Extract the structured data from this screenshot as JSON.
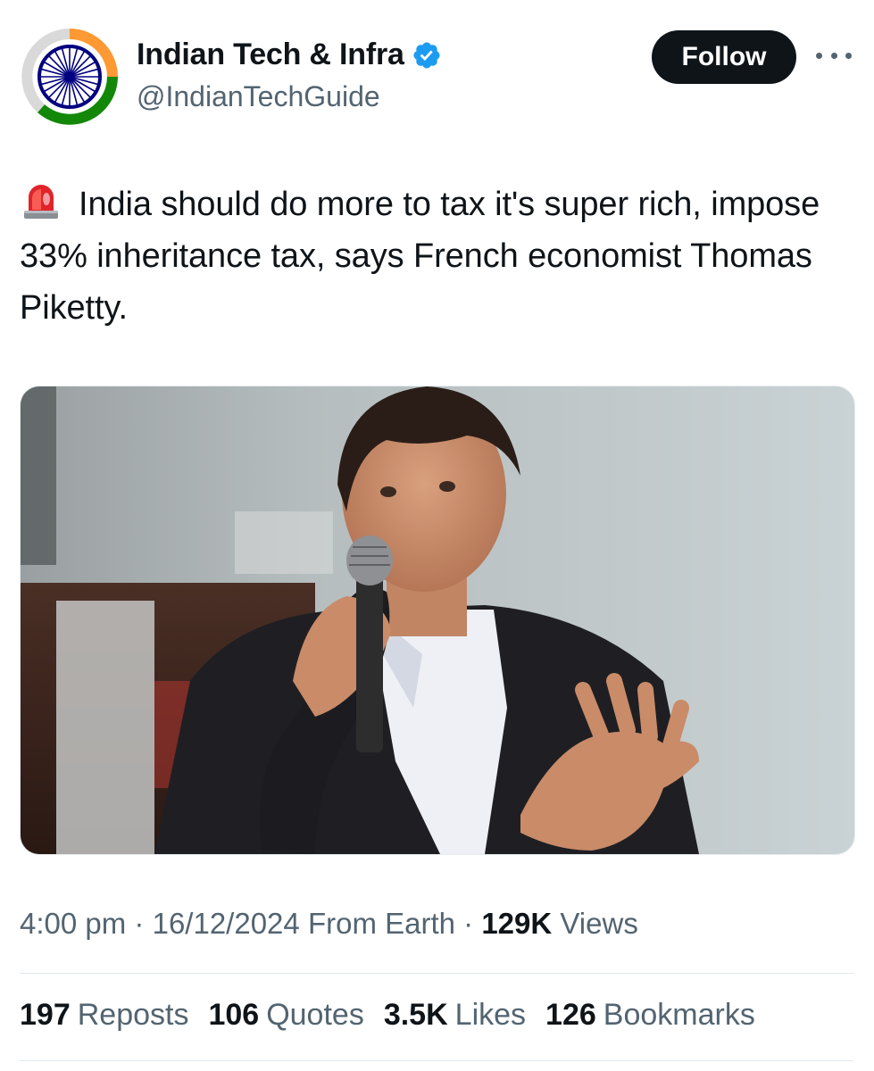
{
  "author": {
    "name": "Indian Tech & Infra",
    "handle": "@IndianTechGuide",
    "verified": true,
    "avatar_icon": "indian-flag-ashoka-chakra-icon"
  },
  "actions": {
    "follow_label": "Follow",
    "more_icon": "more-options-icon"
  },
  "tweet": {
    "emoji_icon": "police-siren-icon",
    "text": "India should do more to tax it's super rich, impose 33% inheritance tax, says French economist Thomas Piketty."
  },
  "meta": {
    "time": "4:00 pm",
    "date": "16/12/2024",
    "source": "From Earth",
    "separator": "·",
    "views_count": "129K",
    "views_label": "Views"
  },
  "stats": [
    {
      "count": "197",
      "label": "Reposts"
    },
    {
      "count": "106",
      "label": "Quotes"
    },
    {
      "count": "3.5K",
      "label": "Likes"
    },
    {
      "count": "126",
      "label": "Bookmarks"
    }
  ],
  "colors": {
    "text_primary": "#0f1419",
    "text_secondary": "#536471",
    "verified_blue": "#1d9bf0",
    "follow_bg": "#0f1419",
    "saffron": "#ff9933",
    "green": "#138808",
    "chakra_blue": "#000080"
  }
}
